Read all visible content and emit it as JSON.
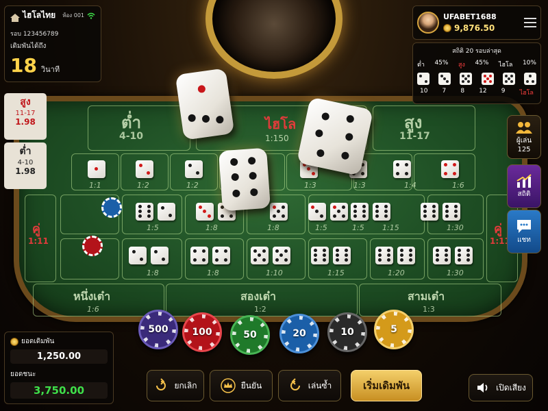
{
  "info": {
    "room_name": "ไฮโลไทย",
    "room_no": "ห้อง 001",
    "round": "รอบ 123456789",
    "bet_until": "เดิมพันได้ถึง",
    "timer": "18",
    "timer_unit": "วินาที"
  },
  "user": {
    "name": "UFABET1688",
    "balance": "9,876.50"
  },
  "stats": {
    "title": "สถิติ 20 รอบล่าสุด",
    "legend": [
      {
        "label": "ต่ำ",
        "pct": "45%",
        "color": "#ffffff"
      },
      {
        "label": "สูง",
        "pct": "45%",
        "color": "#ff4040"
      },
      {
        "label": "ไฮโล",
        "pct": "10%",
        "color": "#ffffff"
      }
    ],
    "results": [
      "10",
      "7",
      "8",
      "12",
      "9",
      "ไฮโล"
    ]
  },
  "history": [
    {
      "name": "สูง",
      "range": "11-17",
      "odds": "1.98",
      "color": "#c0161a"
    },
    {
      "name": "ต่ำ",
      "range": "4-10",
      "odds": "1.98",
      "color": "#222222"
    }
  ],
  "table": {
    "low": {
      "name": "ต่ำ",
      "range": "4-10"
    },
    "hilo": {
      "name": "ไฮโล",
      "odds": "1:150"
    },
    "high": {
      "name": "สูง",
      "range": "11-17"
    },
    "single_odds": [
      "1:1",
      "1:2",
      "1:2",
      "1:3",
      "1:3",
      "1:4",
      "1:6"
    ],
    "pair": {
      "left": "คู่",
      "left_odds": "1:11",
      "right": "คู่",
      "right_odds": "1:11"
    },
    "row2_odds": [
      "1:5",
      "1:8",
      "1:8",
      "1:5",
      "1:5",
      "1:15",
      "1:30"
    ],
    "row3_odds": [
      "1:8",
      "1:8",
      "1:10",
      "1:15",
      "1:20",
      "1:30"
    ],
    "one_low": {
      "name": "หนึ่งเต๋า",
      "odds": "1:6"
    },
    "two_low": {
      "name": "สองเต๋า",
      "odds": "1:2"
    },
    "three_low": {
      "name": "สามเต๋า",
      "odds": "1:3"
    }
  },
  "side": {
    "players_label": "ผู้เล่น",
    "players_count": "125",
    "stats_label": "สถิติ",
    "chat_label": "แชท"
  },
  "chips": [
    {
      "value": "500",
      "color": "#3a2a7a"
    },
    {
      "value": "100",
      "color": "#b3131a"
    },
    {
      "value": "50",
      "color": "#1f7a2a"
    },
    {
      "value": "20",
      "color": "#1b5fa8"
    },
    {
      "value": "10",
      "color": "#2a2a2a"
    },
    {
      "value": "5",
      "color": "#d49a1a"
    }
  ],
  "totals": {
    "bet_label": "ยอดเดิมพัน",
    "bet_value": "1,250.00",
    "win_label": "ยอดชนะ",
    "win_value": "3,750.00",
    "win_color": "#3fe04a"
  },
  "buttons": {
    "cancel": "ยกเลิก",
    "confirm": "ยืนยัน",
    "repeat": "เล่นซ้ำ",
    "start": "เริ่มเดิมพัน",
    "sound": "เปิดเสียง"
  }
}
